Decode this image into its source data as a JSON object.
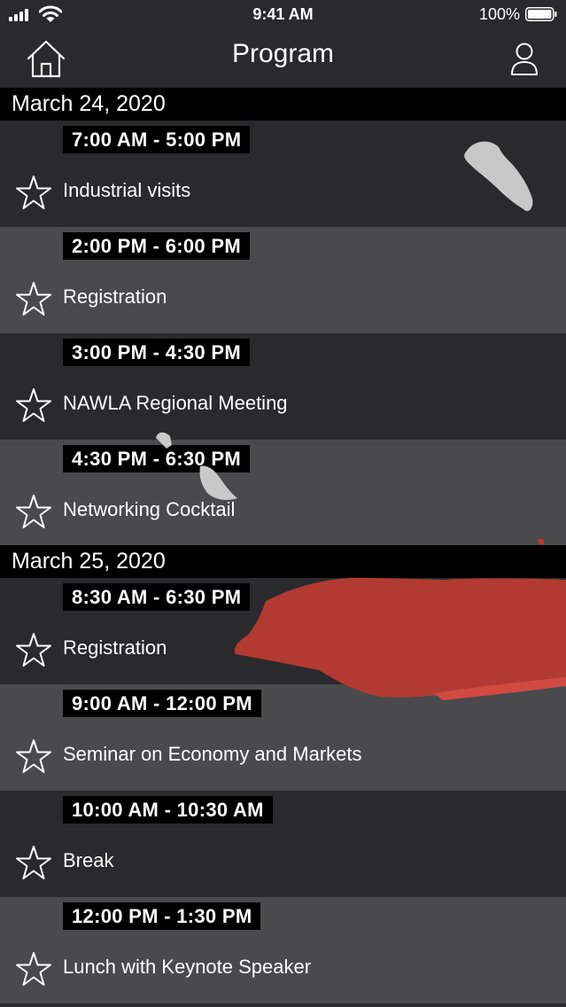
{
  "status_bar": {
    "time": "9:41 AM",
    "battery": "100%",
    "icons": [
      "signal-icon",
      "wifi-icon",
      "battery-icon"
    ]
  },
  "nav": {
    "title": "Program",
    "left_icon": "home-icon",
    "right_icon": "profile-icon"
  },
  "days": [
    {
      "date": "March 24, 2020",
      "sessions": [
        {
          "time": "7:00 AM - 5:00 PM",
          "title": "Industrial visits"
        },
        {
          "time": "2:00 PM - 6:00 PM",
          "title": "Registration"
        },
        {
          "time": "3:00 PM - 4:30 PM",
          "title": "NAWLA Regional Meeting"
        },
        {
          "time": "4:30 PM - 6:30 PM",
          "title": "Networking Cocktail"
        }
      ]
    },
    {
      "date": "March 25, 2020",
      "sessions": [
        {
          "time": "8:30 AM - 6:30 PM",
          "title": "Registration"
        },
        {
          "time": "9:00 AM - 12:00 PM",
          "title": "Seminar on Economy and Markets"
        },
        {
          "time": "10:00 AM - 10:30 AM",
          "title": "Break"
        },
        {
          "time": "12:00 PM - 1:30 PM",
          "title": "Lunch with Keynote Speaker"
        }
      ]
    }
  ],
  "colors": {
    "background": "#2a292b",
    "row_alt": "#4a494b",
    "header": "#000000",
    "accent_splash": "#b23a33",
    "splash_light": "#c8c8c8"
  },
  "favorite_icon": "star-outline-icon"
}
